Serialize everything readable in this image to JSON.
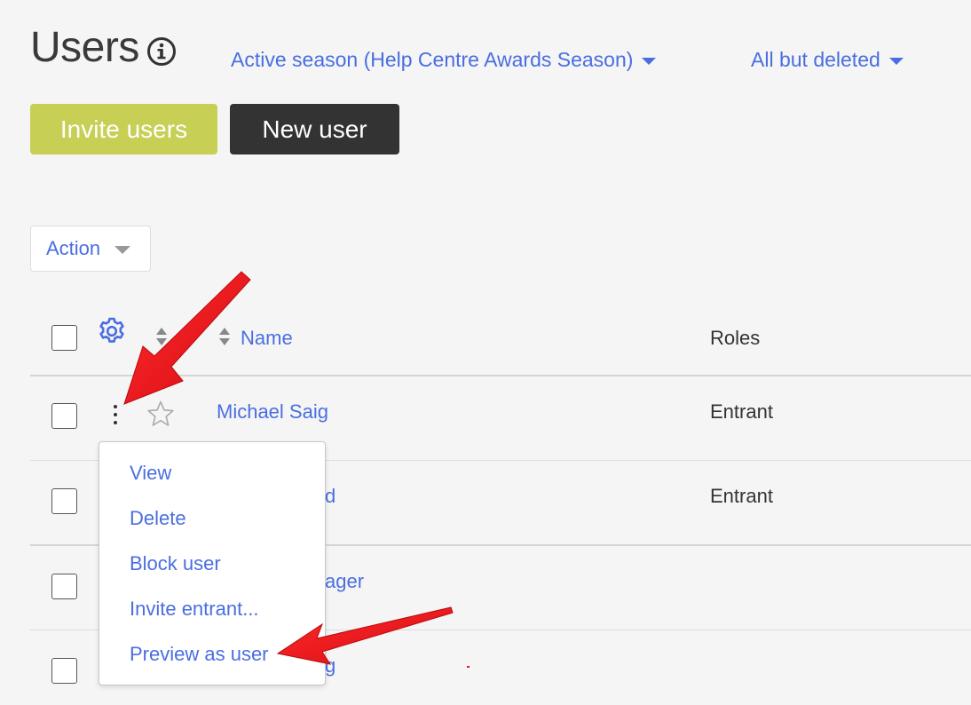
{
  "header": {
    "title": "Users",
    "season_filter": "Active season (Help Centre Awards Season)",
    "status_filter": "All but deleted"
  },
  "toolbar": {
    "invite_label": "Invite users",
    "new_user_label": "New user",
    "action_label": "Action"
  },
  "table": {
    "columns": {
      "name": "Name",
      "roles": "Roles"
    },
    "rows": [
      {
        "name": "Michael Saig",
        "role": "Entrant"
      },
      {
        "name": "d",
        "role": "Entrant"
      },
      {
        "name": "ager",
        "role": ""
      },
      {
        "name": "g",
        "role": ""
      }
    ]
  },
  "row_menu": {
    "items": [
      {
        "label": "View"
      },
      {
        "label": "Delete"
      },
      {
        "label": "Block user"
      },
      {
        "label": "Invite entrant..."
      },
      {
        "label": "Preview as user"
      }
    ]
  },
  "colors": {
    "link_blue": "#4a6ee0",
    "invite_button": "#c7cf55",
    "new_user_button": "#333333",
    "annotation_red": "#e8141e"
  },
  "icons": {
    "info": "info-icon",
    "gear": "gear-icon",
    "sort": "sort-icon",
    "star": "star-icon",
    "kebab": "kebab-menu-icon"
  }
}
